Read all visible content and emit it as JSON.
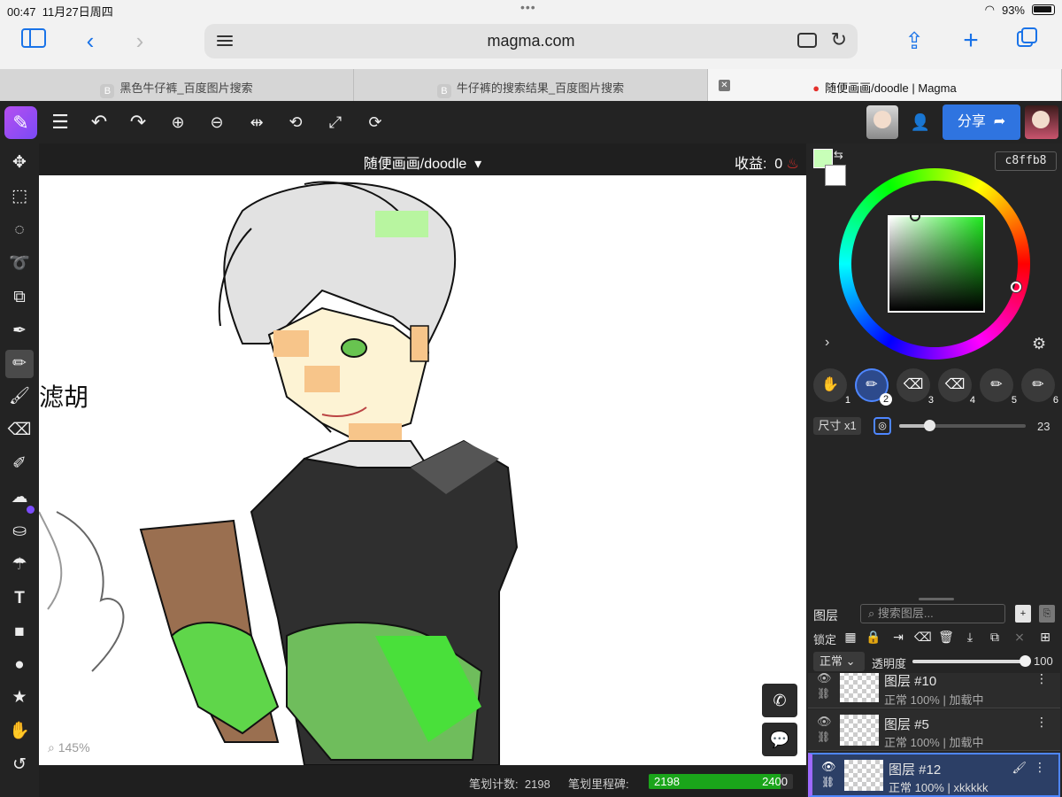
{
  "status": {
    "time": "00:47",
    "date": "11月27日周四",
    "battery": "93%"
  },
  "browser": {
    "url": "magma.com",
    "tabs": [
      {
        "label": "黑色牛仔裤_百度图片搜索",
        "fav": "B"
      },
      {
        "label": "牛仔裤的搜索结果_百度图片搜索",
        "fav": "B"
      },
      {
        "label": "随便画画/doodle | Magma",
        "close": "✕"
      }
    ]
  },
  "app": {
    "share_label": "分享",
    "canvas_title": "随便画画/doodle",
    "earnings_label": "收益:",
    "earnings_value": "0",
    "zoom": "145%",
    "stroke_count_label": "笔划计数:",
    "stroke_count": "2198",
    "milestone_label": "笔划里程碑:",
    "milestone_current": "2198",
    "milestone_target": "2400",
    "milestone_fraction": 0.916
  },
  "color": {
    "hex": "c8ffb8",
    "foreground": "#c8ffb8",
    "background": "#ffffff"
  },
  "brushes": [
    {
      "n": "1",
      "icon": "hand-icon"
    },
    {
      "n": "2",
      "icon": "pencil-icon",
      "selected": true
    },
    {
      "n": "3",
      "icon": "eraser-icon"
    },
    {
      "n": "4",
      "icon": "eraser-icon"
    },
    {
      "n": "5",
      "icon": "pencil-icon"
    },
    {
      "n": "6",
      "icon": "pencil-icon"
    }
  ],
  "brush_size": {
    "label": "尺寸 x1",
    "value": "23",
    "fraction": 0.24
  },
  "layers_panel": {
    "title": "图层",
    "search_placeholder": "搜索图层...",
    "lock_label": "锁定",
    "blend_mode": "正常",
    "opacity_label": "透明度",
    "opacity_value": "100",
    "layers": [
      {
        "name": "图层 #10",
        "sub": "正常 100% | 加载中"
      },
      {
        "name": "图层 #5",
        "sub": "正常 100% | 加载中"
      },
      {
        "name": "图层 #12",
        "sub": "正常 100% | xkkkkk",
        "selected": true
      }
    ]
  }
}
